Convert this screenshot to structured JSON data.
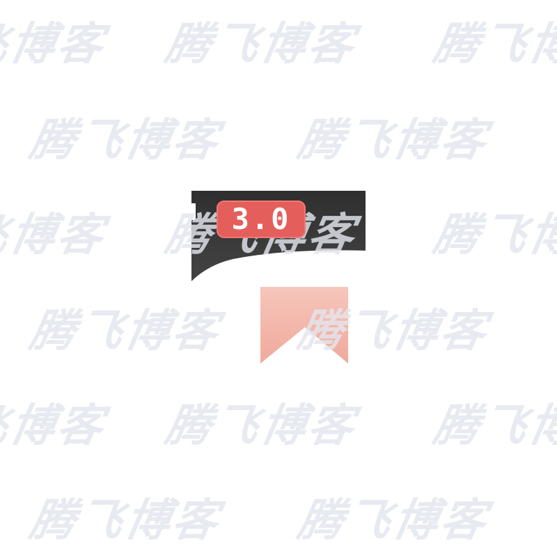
{
  "watermark": {
    "text": "腾飞博客",
    "color": "#e3e6ee"
  },
  "app_icon": {
    "version_badge": "3.0",
    "badge_color": "#e45f5c",
    "frame_color": "#3a3a3a",
    "bookmark_color": "#f4b8ad"
  }
}
